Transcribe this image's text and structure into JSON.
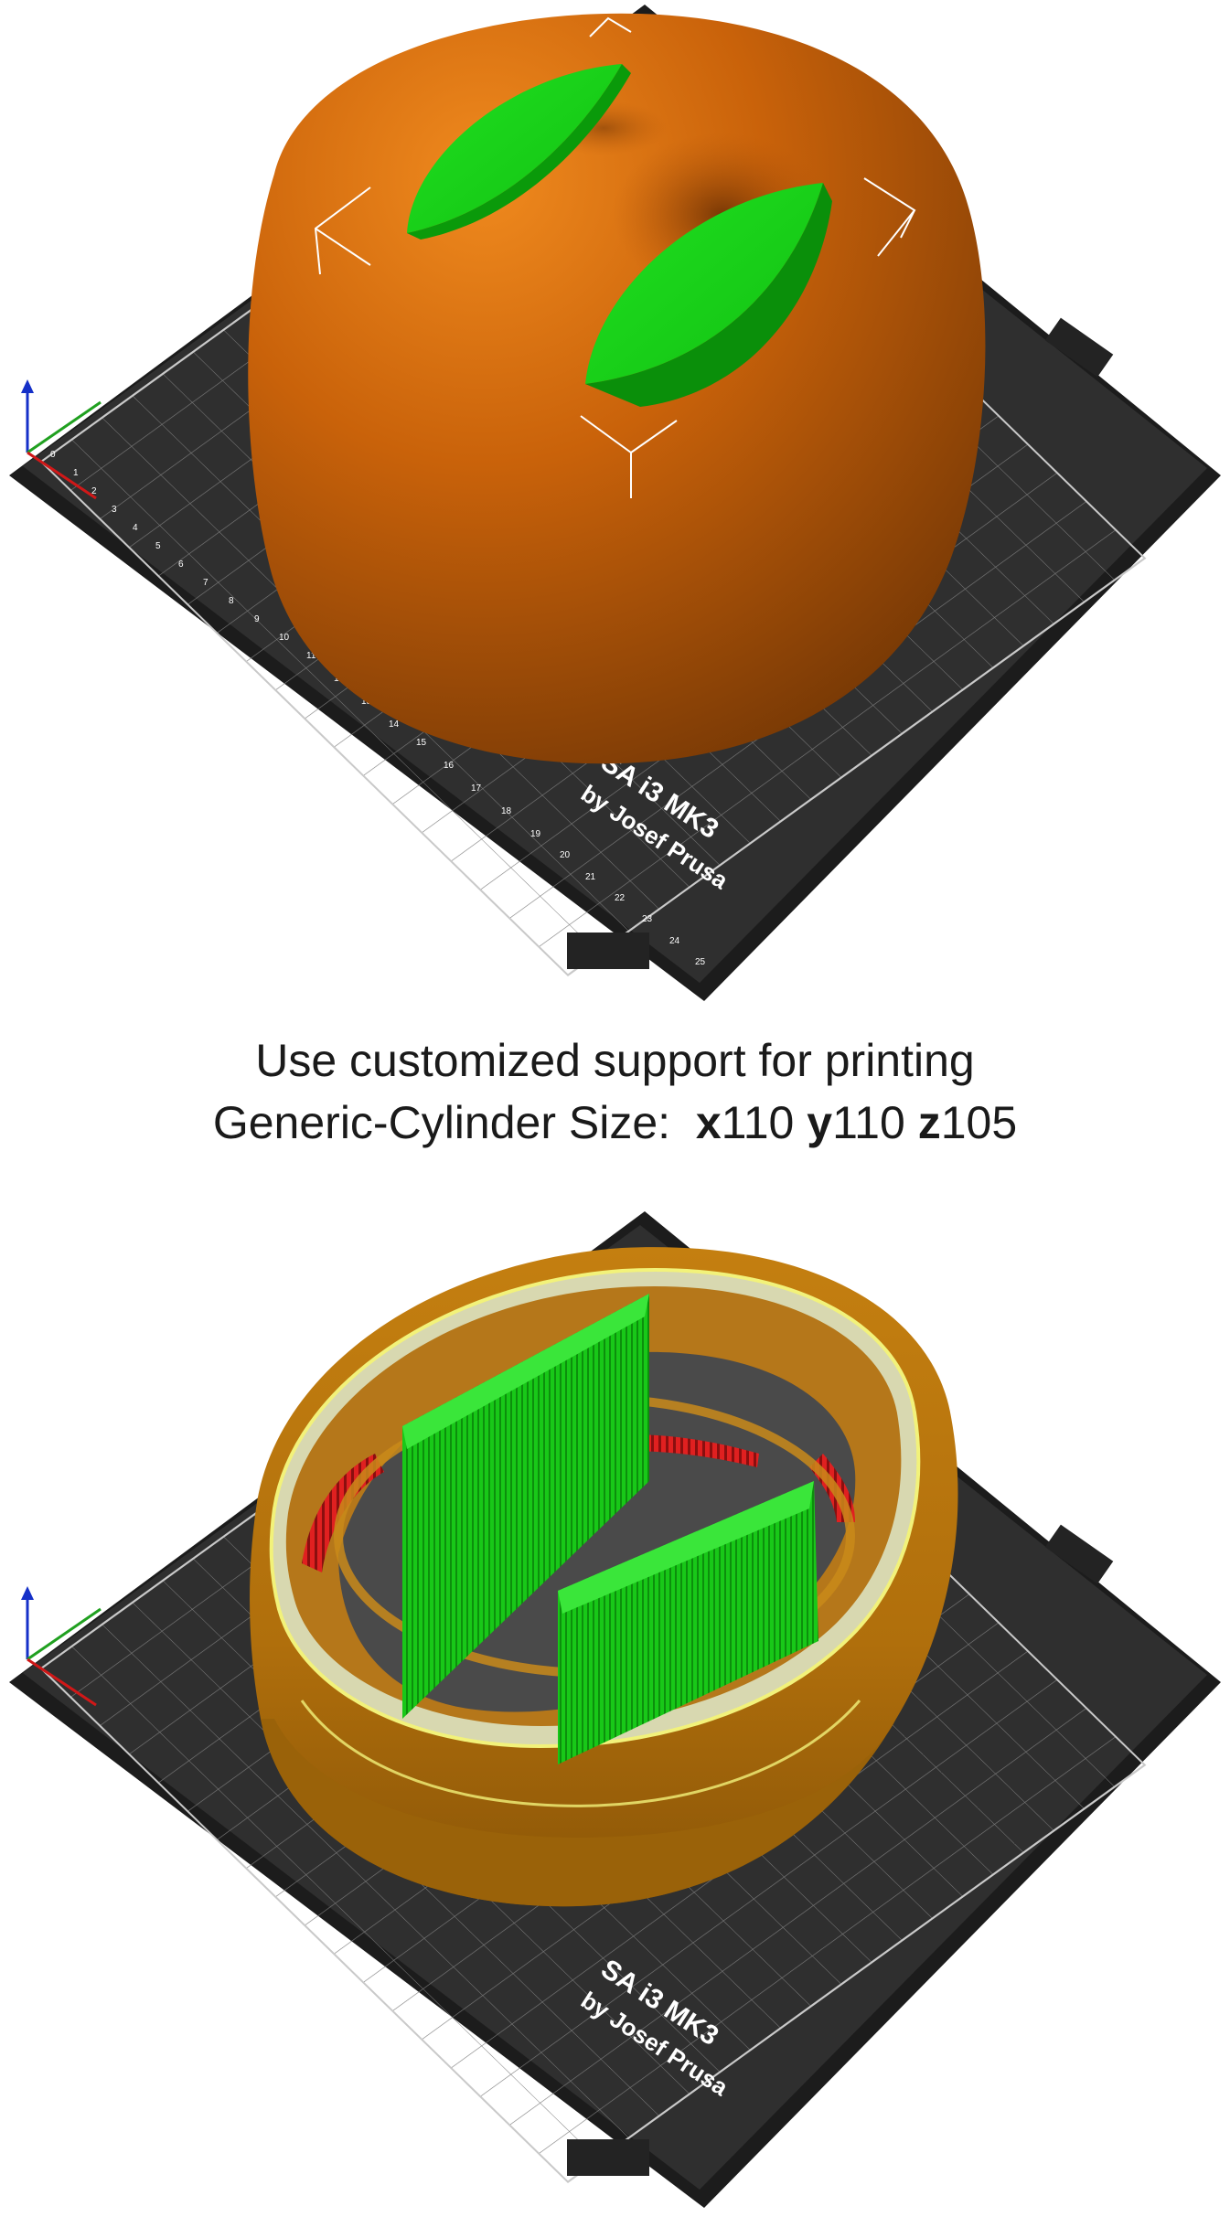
{
  "caption": {
    "line1": "Use customized support for printing",
    "line2_prefix": "Generic-Cylinder Size:",
    "dims": [
      {
        "axis": "x",
        "value": "110"
      },
      {
        "axis": "y",
        "value": "110"
      },
      {
        "axis": "z",
        "value": "105"
      }
    ]
  },
  "plate": {
    "brand_line1": "SA i3 MK3",
    "brand_line2": "by Josef Prusa",
    "ticks": [
      "0",
      "1",
      "2",
      "3",
      "4",
      "5",
      "6",
      "7",
      "8",
      "9",
      "10",
      "11",
      "12",
      "13",
      "14",
      "15",
      "16",
      "17",
      "18",
      "19",
      "20",
      "21",
      "22",
      "23",
      "24",
      "25"
    ]
  },
  "colors": {
    "plate": "#2e2e2e",
    "plate_edge": "#1c1c1c",
    "grid": "#8a8a8a",
    "model_orange": "#d4700f",
    "support_green": "#1fd11f",
    "gcode_orange": "#c9820f",
    "gcode_red": "#e02020"
  },
  "icons": {
    "axis": "xyz-axis-icon",
    "selection": "selection-corner-icon"
  }
}
